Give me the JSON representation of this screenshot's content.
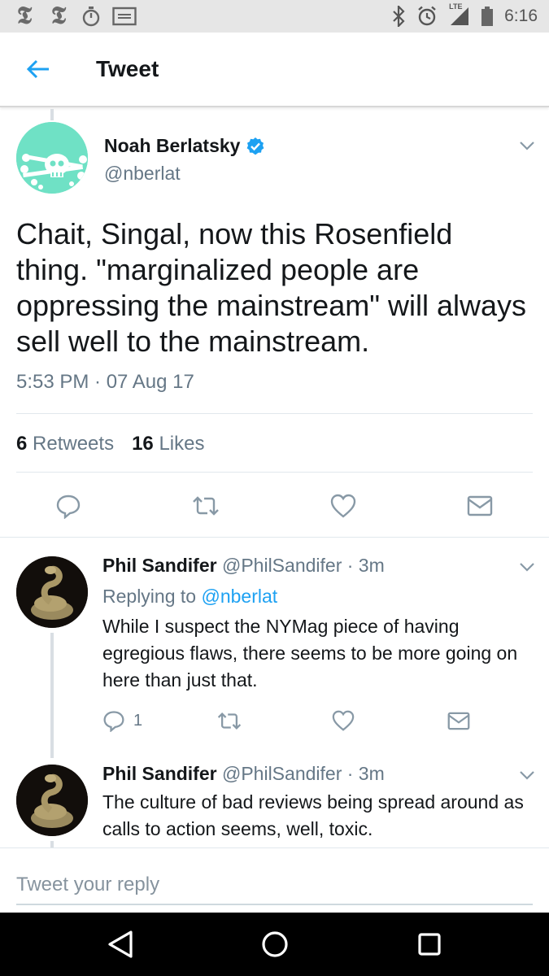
{
  "status_bar": {
    "time": "6:16",
    "network": "LTE",
    "icons": [
      "nyt-icon",
      "nyt-icon",
      "stopwatch-icon",
      "voicemail-icon",
      "bluetooth-icon",
      "alarm-icon",
      "signal-icon",
      "battery-icon"
    ],
    "nyt_glyph": "𝕿"
  },
  "app_bar": {
    "title": "Tweet",
    "back_icon": "arrow-left-icon",
    "accent": "#1da1f2"
  },
  "main_tweet": {
    "author_name": "Noah Berlatsky",
    "verified": true,
    "handle": "@nberlat",
    "text": "Chait, Singal, now this Rosenfield thing. \"marginalized people are oppressing the mainstream\" will always sell well to the mainstream.",
    "timestamp": "5:53 PM · 07 Aug 17",
    "retweets_count": "6",
    "retweets_label": "Retweets",
    "likes_count": "16",
    "likes_label": "Likes"
  },
  "replies": [
    {
      "author_name": "Phil Sandifer",
      "handle": "@PhilSandifer",
      "time": "· 3m",
      "replying_to_label": "Replying to",
      "replying_to_handle": "@nberlat",
      "text": "While I suspect the NYMag piece of having egregious flaws, there seems to be more going on here than just that.",
      "reply_count": "1"
    },
    {
      "author_name": "Phil Sandifer",
      "handle": "@PhilSandifer",
      "time": "· 3m",
      "text": "The culture of bad reviews being spread around as calls to action seems, well, toxic."
    }
  ],
  "composer": {
    "placeholder": "Tweet your reply"
  },
  "colors": {
    "text_primary": "#14171a",
    "text_secondary": "#657786",
    "accent": "#1da1f2",
    "divider": "#e1e8ed"
  }
}
